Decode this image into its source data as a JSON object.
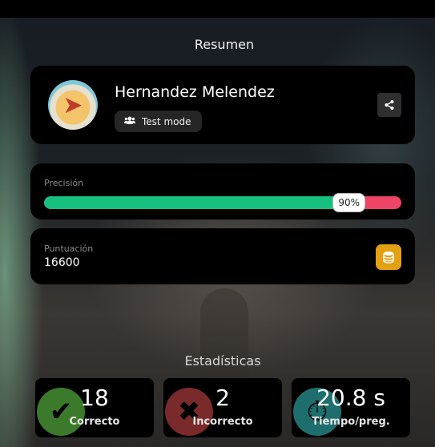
{
  "header": {
    "title": "Resumen"
  },
  "profile": {
    "name": "Hernandez Melendez",
    "mode_label": "Test mode",
    "mode_icon": "users-icon",
    "share_icon": "share-icon",
    "avatar": "profile-avatar"
  },
  "precision": {
    "label": "Precisión",
    "percent_text": "90%",
    "fraction": 0.9,
    "colors": {
      "correct": "#17c080",
      "incorrect": "#ee4466"
    }
  },
  "score": {
    "label": "Puntuación",
    "value": "16600",
    "icon": "coins-icon",
    "icon_color": "#e2a012"
  },
  "stats": {
    "title": "Estadísticas",
    "items": [
      {
        "value": "18",
        "caption": "Correcto",
        "icon": "check-icon",
        "color": "#3a7a2a"
      },
      {
        "value": "2",
        "caption": "Incorrecto",
        "icon": "x-icon",
        "color": "#7a2a2a"
      },
      {
        "value": "20.8 s",
        "caption": "Tiempo/preg.",
        "icon": "timer-icon",
        "color": "#1f6e6e"
      }
    ]
  }
}
